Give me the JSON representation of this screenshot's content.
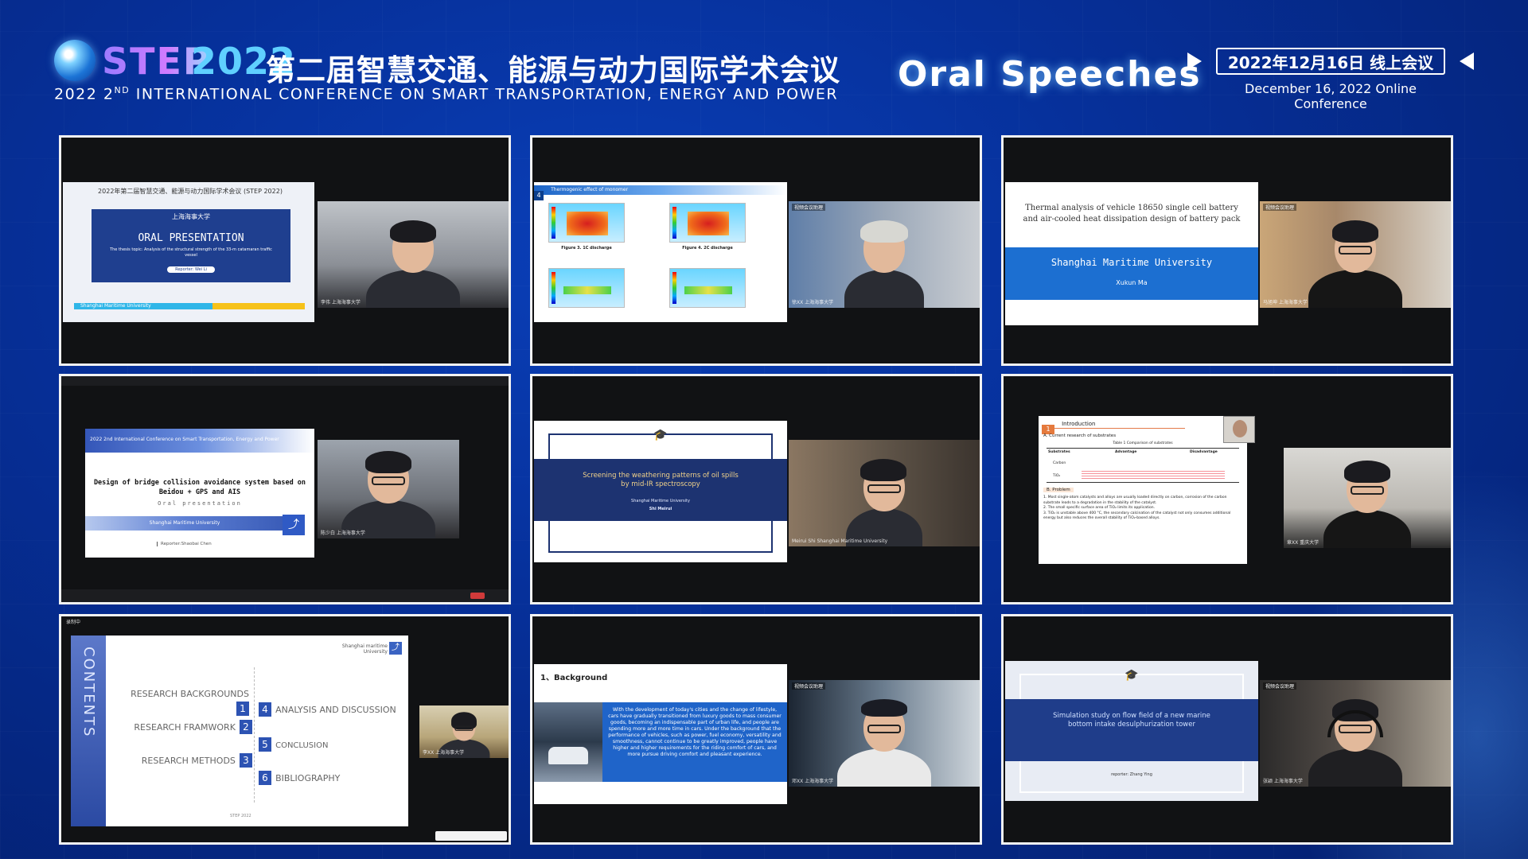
{
  "header": {
    "brand": "STEP",
    "year": "2022",
    "cn_title": "第二届智慧交通、能源与动力国际学术会议",
    "en_title_prefix": "2022 2",
    "en_title_sup": "ND",
    "en_title_rest": " INTERNATIONAL CONFERENCE ON SMART TRANSPORTATION, ENERGY AND POWER",
    "section_title": "Oral  Speeches",
    "date_cn": "2022年12月16日  线上会议",
    "date_en": "December 16, 2022  Online Conference"
  },
  "tiles": {
    "t1": {
      "slide_header": "2022年第二届智慧交通、能源与动力国际学术会议 (STEP 2022)",
      "university_cn": "上海海事大学",
      "title": "ORAL PRESENTATION",
      "subtitle": "The thesis topic:  Analysis of the structural strength of the 33-m catamaran traffic vessel",
      "reporter": "Reporter: Wei Li",
      "footer": "Shanghai Maritime University",
      "cam_label": "李伟 上海海事大学"
    },
    "t2": {
      "section_no": "4",
      "section": "Thermogenic effect of monomer",
      "fig3": "Figure 3. 1C discharge",
      "fig4": "Figure 4. 2C discharge",
      "cam_tag": "视频会议助理",
      "cam_label": "徐XX 上海海事大学"
    },
    "t3": {
      "title": "Thermal analysis of vehicle 18650 single cell battery and air-cooled heat dissipation design of battery pack",
      "university": "Shanghai Maritime University",
      "author": "Xukun  Ma",
      "cam_tag": "视频会议助理",
      "cam_label": "马旭坤 上海海事大学"
    },
    "t4": {
      "banner": "2022 2nd International Conference on Smart Transportation,  Energy and Power",
      "title": "Design of bridge collision avoidance system based on Beidou + GPS and AIS",
      "sub": "Oral presentation",
      "university": "Shanghai Maritime University",
      "reporter": "Reporter:Shaobai Chen",
      "cam_label": "陈少白 上海海事大学"
    },
    "t5": {
      "title": "Screening the weathering patterns of oil spills by mid-IR spectroscopy",
      "university": "Shanghai Maritime University",
      "author": "Shi Meirui",
      "cam_label": "Meirui Shi Shanghai Maritime University"
    },
    "t6": {
      "section_no": "1",
      "section": "Introduction",
      "sub_a": "A. Current research of substrates",
      "table_caption": "Table 1 Comparison of substrates",
      "col1": "Substrates",
      "col2": "Advantage",
      "col3": "Disadvantage",
      "row1": "Carbon",
      "row2": "TiO₂",
      "sub_b": "B. Problem",
      "p1": "1. Most single-atom catalysts and alloys are usually loaded directly on carbon, corrosion of the carbon substrate leads to a degradation in the stability of the catalyst.",
      "p2": "2. The small specific surface area of TiO₂ limits its application.",
      "p3": "3. TiO₂ is unstable above 400 °C, the secondary calcination of the catalyst not only consumes additional energy but also reduces the overall stability of TiO₂-based alloys.",
      "cam_label": "章XX 重庆大学"
    },
    "t7": {
      "contents": "CONTENTS",
      "logo_text": "Shanghai maritime University",
      "items": [
        {
          "n": "1",
          "label": "RESEARCH BACKGROUNDS"
        },
        {
          "n": "2",
          "label": "RESEARCH FRAMWORK"
        },
        {
          "n": "3",
          "label": "RESEARCH METHODS"
        },
        {
          "n": "4",
          "label": "ANALYSIS AND DISCUSSION"
        },
        {
          "n": "5",
          "label": "CONCLUSION"
        },
        {
          "n": "6",
          "label": "BIBLIOGRAPHY"
        }
      ],
      "footer": "STEP 2022",
      "top_tag": "录制中",
      "cam_label": "李XX 上海海事大学"
    },
    "t8": {
      "heading": "1、Background",
      "body": "With the development of today's cities and the change of lifestyle, cars have gradually transitioned from luxury goods to mass consumer goods, becoming an indispensable part of urban life, and people are spending more and more time in cars. Under the background that the performance of vehicles, such as power, fuel economy, versatility and smoothness, cannot continue to be greatly improved, people have higher and higher requirements for the riding comfort of cars, and more pursue driving comfort and pleasant experience.",
      "cam_tag": "视频会议助理",
      "cam_label": "邓XX 上海海事大学"
    },
    "t9": {
      "title": "Simulation study on flow field of a new marine bottom intake desulphurization tower",
      "reporter": "reporter:  Zhang Ying",
      "cam_tag": "视频会议助理",
      "cam_label": "张颖 上海海事大学"
    }
  }
}
